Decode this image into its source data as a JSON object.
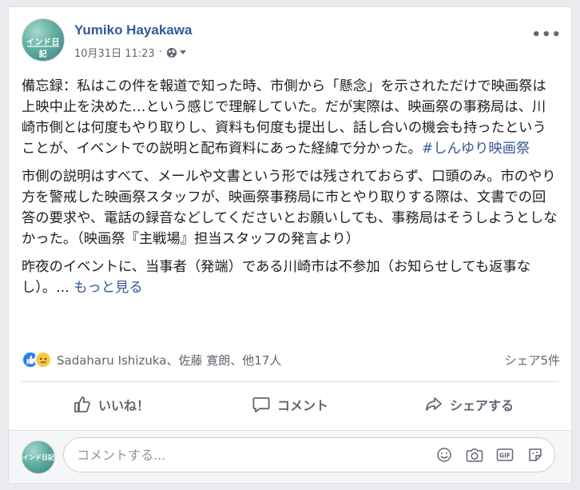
{
  "post": {
    "author_name": "Yumiko Hayakawa",
    "timestamp": "10月31日 11:23",
    "avatar_text": "インド日記",
    "paragraphs": [
      {
        "text": "備忘録：私はこの件を報道で知った時、市側から「懸念」を示されただけで映画祭は上映中止を決めた…という感じで理解していた。だが実際は、映画祭の事務局は、川崎市側とは何度もやり取りし、資料も何度も提出し、話し合いの機会も持ったということが、イベントでの説明と配布資料にあった経緯で分かった。",
        "hashtag": "#しんゆり映画祭"
      },
      {
        "text": "市側の説明はすべて、メールや文書という形では残されておらず、口頭のみ。市のやり方を警戒した映画祭スタッフが、映画祭事務局に市とやり取りする際は、文書での回答の要求や、電話の録音などしてくださいとお願いしても、事務局はそうしようとしなかった。（映画祭『主戦場』担当スタッフの発言より）"
      },
      {
        "text": "昨夜のイベントに、当事者（発端）である川崎市は不参加（お知らせしても返事なし）。...",
        "see_more": "もっと見る"
      }
    ]
  },
  "reactions": {
    "names": "Sadaharu Ishizuka、佐藤 寛朗、他17人",
    "shares": "シェア5件",
    "icons": [
      "like-reaction-icon",
      "sad-reaction-icon"
    ]
  },
  "actions": {
    "like_label": "いいね！",
    "comment_label": "コメント",
    "share_label": "シェアする"
  },
  "comment": {
    "placeholder": "コメントする...",
    "tools": [
      "emoji-icon",
      "camera-icon",
      "gif-icon",
      "sticker-icon"
    ]
  },
  "colors": {
    "link": "#365899",
    "like_blue": "#2e7df6",
    "sad_yellow": "#f7c948",
    "muted_text": "#606770"
  }
}
